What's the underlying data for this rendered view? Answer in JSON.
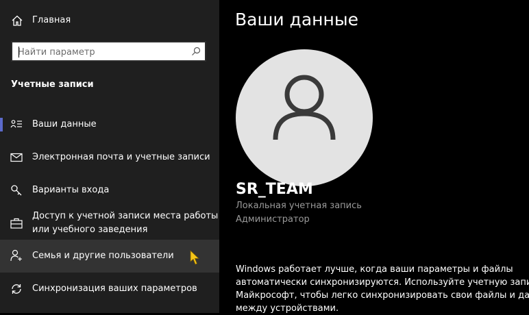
{
  "sidebar": {
    "home_label": "Главная",
    "search_placeholder": "Найти параметр",
    "section_title": "Учетные записи",
    "items": [
      {
        "icon": "person-card-icon",
        "label": "Ваши данные"
      },
      {
        "icon": "mail-icon",
        "label": "Электронная почта и учетные записи"
      },
      {
        "icon": "key-icon",
        "label": "Варианты входа"
      },
      {
        "icon": "briefcase-icon",
        "label_line1": "Доступ к учетной записи места работы",
        "label_line2": "или учебного заведения"
      },
      {
        "icon": "add-person-icon",
        "label": "Семья и другие пользователи"
      },
      {
        "icon": "sync-icon",
        "label": "Синхронизация ваших параметров"
      }
    ]
  },
  "main": {
    "title": "Ваши данные",
    "user_name": "SR_TEAM",
    "account_type": "Локальная учетная запись",
    "role": "Администратор",
    "info_lines": [
      "Windows работает лучше, когда ваши параметры и файлы",
      "автоматически синхронизируются. Используйте учетную запись",
      "Майкрософт, чтобы легко синхронизировать свои файлы и данны",
      "между устройствами."
    ]
  },
  "colors": {
    "sidebar_bg": "#1f1f1f",
    "main_bg": "#000000",
    "accent": "#5c6acb",
    "hover_bg": "#333333",
    "avatar_bg": "#e3e3e3"
  }
}
